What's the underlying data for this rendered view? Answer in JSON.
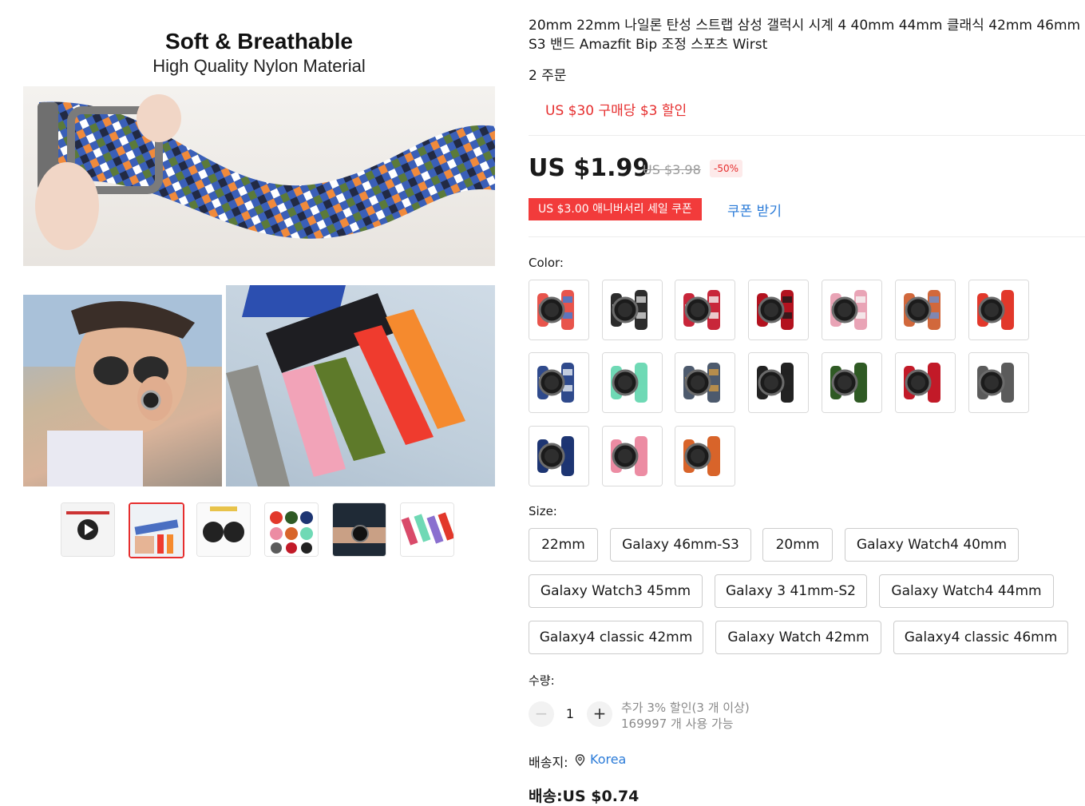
{
  "gallery": {
    "banner_title": "Soft & Breathable",
    "banner_subtitle": "High Quality Nylon Material",
    "thumb_count": 6,
    "active_thumb": 2
  },
  "product": {
    "title": "20mm 22mm 나일론 탄성 스트랩 삼성 갤럭시 시계 4 40mm 44mm 클래식 42mm 46mm S3 밴드 Amazfit Bip 조정 스포츠 Wirst",
    "orders": "2 주문",
    "store_promo": "US $30 구매당 $3 할인",
    "price": "US $1.99",
    "original_price": "US $3.98",
    "discount": "-50%",
    "coupon_label": "US $3.00 애니버서리 세일 쿠폰",
    "coupon_get": "쿠폰 받기"
  },
  "color": {
    "label": "Color:",
    "swatches": [
      {
        "name": "rainbow",
        "c1": "#e8544c",
        "c2": "#3b7dd8"
      },
      {
        "name": "black-white",
        "c1": "#2c2c2c",
        "c2": "#d9d9d9"
      },
      {
        "name": "red-white",
        "c1": "#c8263a",
        "c2": "#f2f2f2"
      },
      {
        "name": "red-black",
        "c1": "#b3121f",
        "c2": "#1a1a1a"
      },
      {
        "name": "pink-white",
        "c1": "#e9a4b6",
        "c2": "#f6f6f6"
      },
      {
        "name": "multicolor",
        "c1": "#d1683c",
        "c2": "#6c8fd0"
      },
      {
        "name": "red",
        "c1": "#e2382b",
        "c2": "#e2382b"
      },
      {
        "name": "blue-white",
        "c1": "#2f4a8c",
        "c2": "#e9edf4"
      },
      {
        "name": "mint",
        "c1": "#6fd9b5",
        "c2": "#6fd9b5"
      },
      {
        "name": "camo",
        "c1": "#4d5a6d",
        "c2": "#d19a44"
      },
      {
        "name": "black",
        "c1": "#222222",
        "c2": "#222222"
      },
      {
        "name": "green",
        "c1": "#2f5a24",
        "c2": "#2f5a24"
      },
      {
        "name": "wine-red",
        "c1": "#c21a28",
        "c2": "#c21a28"
      },
      {
        "name": "grey",
        "c1": "#5b5b5b",
        "c2": "#5b5b5b"
      },
      {
        "name": "navy",
        "c1": "#1d3572",
        "c2": "#1d3572"
      },
      {
        "name": "pink",
        "c1": "#ec8ca3",
        "c2": "#ec8ca3"
      },
      {
        "name": "orange",
        "c1": "#d8642a",
        "c2": "#d8642a"
      }
    ]
  },
  "size": {
    "label": "Size:",
    "options": [
      "22mm",
      "Galaxy 46mm-S3",
      "20mm",
      "Galaxy Watch4 40mm",
      "Galaxy Watch3 45mm",
      "Galaxy 3 41mm-S2",
      "Galaxy Watch4 44mm",
      "Galaxy4 classic 42mm",
      "Galaxy Watch 42mm",
      "Galaxy4 classic 46mm"
    ]
  },
  "quantity": {
    "label": "수량:",
    "minus": "−",
    "plus": "+",
    "value": "1",
    "extra_discount": "추가 3% 할인(3 개 이상)",
    "available": "169997 개 사용 가능"
  },
  "shipping": {
    "ship_to_label": "배송지:",
    "location": "Korea",
    "cost": "배송:US $0.74"
  },
  "colors": {
    "accent": "#e62e2e",
    "link": "#2b7bd8"
  }
}
